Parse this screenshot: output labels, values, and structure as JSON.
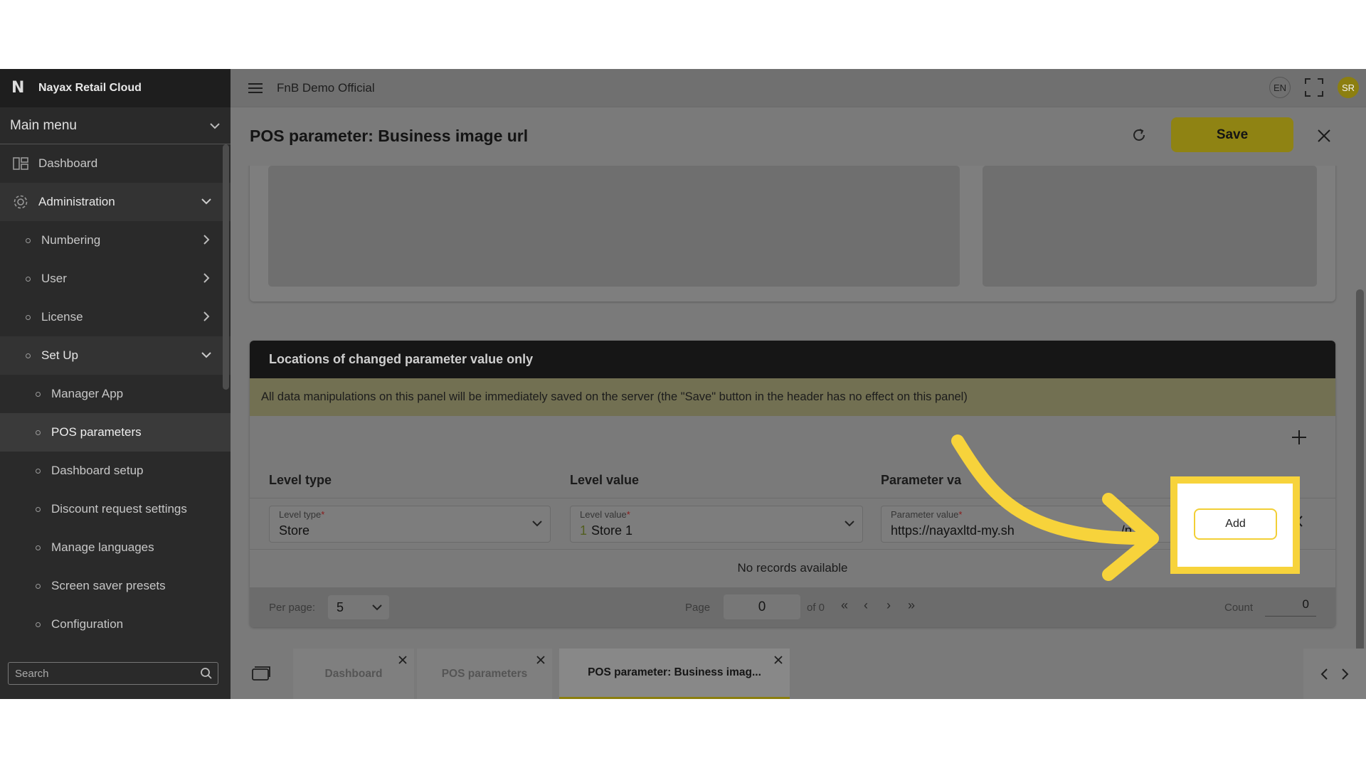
{
  "app_name": "Nayax Retail Cloud",
  "sidebar": {
    "menu_label": "Main menu",
    "items": [
      {
        "label": "Dashboard"
      },
      {
        "label": "Administration"
      },
      {
        "label": "Numbering"
      },
      {
        "label": "User"
      },
      {
        "label": "License"
      },
      {
        "label": "Set Up"
      },
      {
        "label": "Manager App"
      },
      {
        "label": "POS parameters"
      },
      {
        "label": "Dashboard setup"
      },
      {
        "label": "Discount request settings"
      },
      {
        "label": "Manage languages"
      },
      {
        "label": "Screen saver presets"
      },
      {
        "label": "Configuration"
      }
    ],
    "search_placeholder": "Search"
  },
  "topbar": {
    "title": "FnB Demo Official",
    "lang": "EN",
    "avatar": "SR"
  },
  "page": {
    "title": "POS parameter: Business image url",
    "save_label": "Save"
  },
  "locations": {
    "title": "Locations of changed parameter value only",
    "note": "All data manipulations on this panel will be immediately saved on the server (the \"Save\" button in the header has no effect on this panel)",
    "columns": [
      "Level type",
      "Level value",
      "Parameter va"
    ],
    "row": {
      "level_type_label": "Level type",
      "level_type_value": "Store",
      "level_value_label": "Level value",
      "level_value_num": "1",
      "level_value_value": "Store 1",
      "param_label": "Parameter value",
      "param_value": "https://nayaxltd-my.sh",
      "param_value_tail": "/p"
    },
    "empty_text": "No records available",
    "add_label": "Add"
  },
  "pager": {
    "per_page_label": "Per page:",
    "per_page_value": "5",
    "page_label": "Page",
    "page_value": "0",
    "of_label": "of 0",
    "count_label": "Count",
    "count_value": "0"
  },
  "tabs": [
    {
      "label": "Dashboard"
    },
    {
      "label": "POS parameters"
    },
    {
      "label": "POS parameter: Business imag..."
    }
  ],
  "colors": {
    "accent": "#f7d33b",
    "save_button": "#8f8313"
  }
}
